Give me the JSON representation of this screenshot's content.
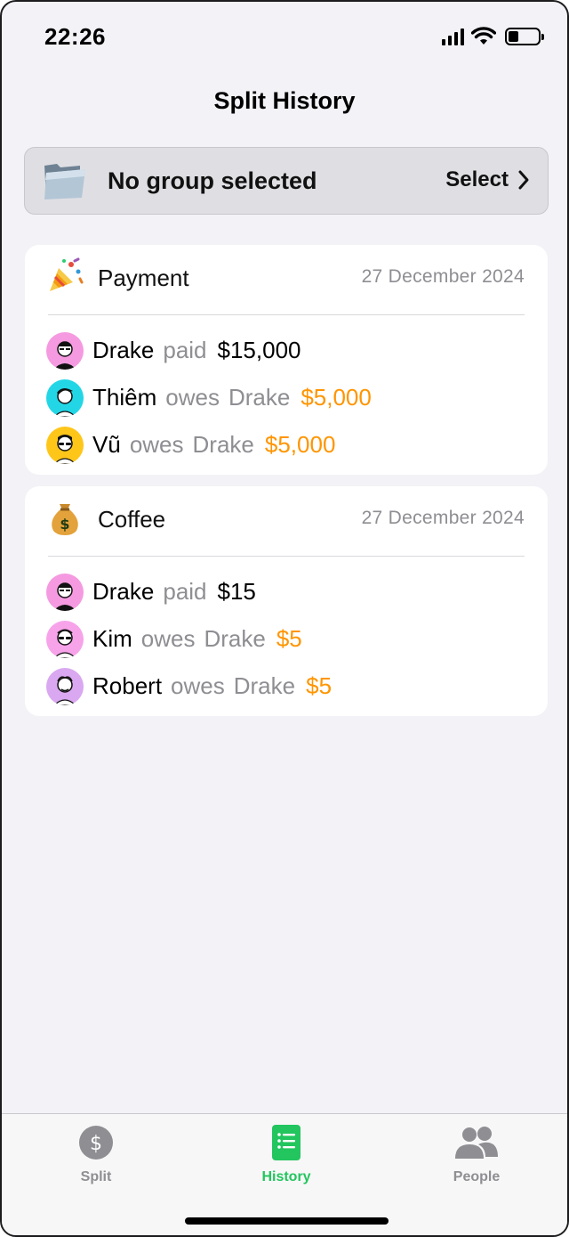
{
  "status_bar": {
    "time": "22:26"
  },
  "nav": {
    "title": "Split History"
  },
  "group_selector": {
    "label": "No group selected",
    "action": "Select"
  },
  "splits": [
    {
      "title": "Payment",
      "icon": "party-popper-icon",
      "date": "27 December 2024",
      "entries": [
        {
          "name": "Drake",
          "verb": "paid",
          "target": "",
          "amount": "$15,000",
          "avatar_color": "#f59ae0"
        },
        {
          "name": "Thiêm",
          "verb": "owes",
          "target": "Drake",
          "amount": "$5,000",
          "avatar_color": "#23d6e6"
        },
        {
          "name": "Vũ",
          "verb": "owes",
          "target": "Drake",
          "amount": "$5,000",
          "avatar_color": "#ffc61a"
        }
      ]
    },
    {
      "title": "Coffee",
      "icon": "money-bag-icon",
      "date": "27 December 2024",
      "entries": [
        {
          "name": "Drake",
          "verb": "paid",
          "target": "",
          "amount": "$15",
          "avatar_color": "#f59ae0"
        },
        {
          "name": "Kim",
          "verb": "owes",
          "target": "Drake",
          "amount": "$5",
          "avatar_color": "#f7a3ea"
        },
        {
          "name": "Robert",
          "verb": "owes",
          "target": "Drake",
          "amount": "$5",
          "avatar_color": "#d9a8f0"
        }
      ]
    }
  ],
  "tab_bar": {
    "tabs": [
      {
        "label": "Split",
        "icon": "dollar-circle-icon",
        "active": false
      },
      {
        "label": "History",
        "icon": "list-document-icon",
        "active": true
      },
      {
        "label": "People",
        "icon": "people-icon",
        "active": false
      }
    ],
    "active_color": "#22c55e",
    "inactive_color": "#8e8e93"
  }
}
